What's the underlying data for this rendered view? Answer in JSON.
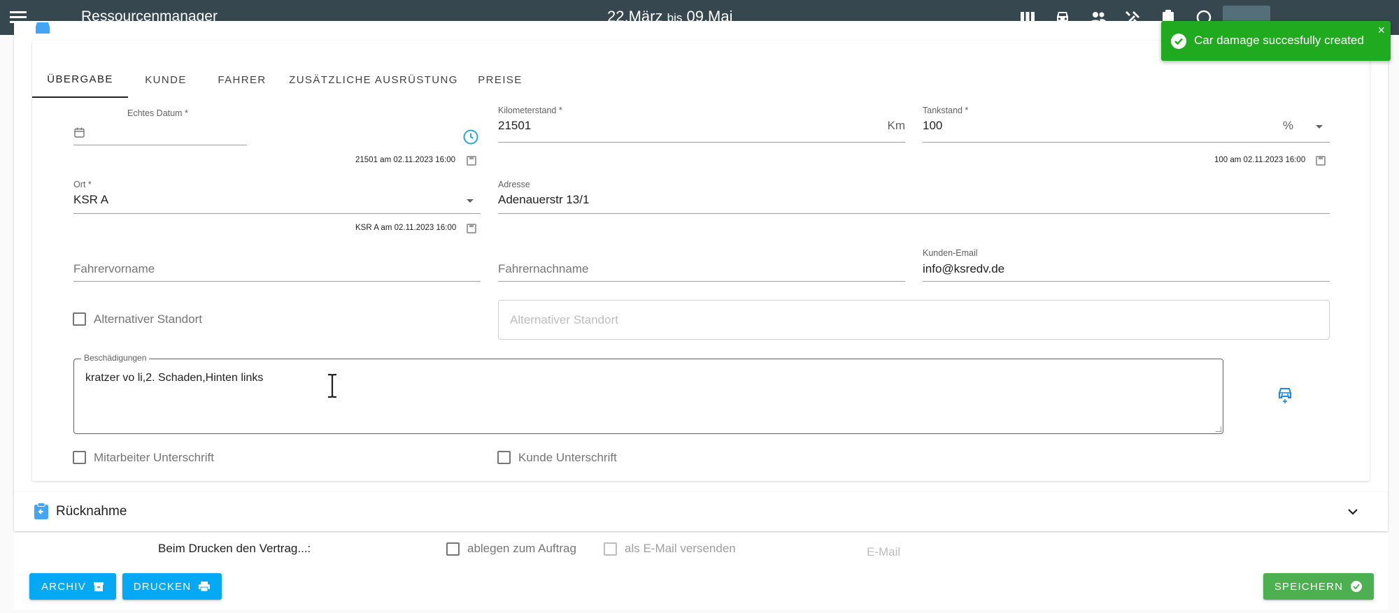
{
  "header": {
    "app_title": "Ressourcenmanager",
    "date_from": "22.März",
    "date_sep": "bis",
    "date_to": "09.Mai"
  },
  "toast": {
    "message": "Car damage succesfully created",
    "close_label": "×"
  },
  "handover": {
    "partial_value": "21501 Km"
  },
  "tabs": [
    {
      "label": "ÜBERGABE"
    },
    {
      "label": "KUNDE"
    },
    {
      "label": "FAHRER"
    },
    {
      "label": "ZUSÄTZLICHE AUSRÜSTUNG"
    },
    {
      "label": "PREISE"
    }
  ],
  "form": {
    "actual_date": {
      "label": "Echtes Datum *",
      "value": ""
    },
    "actual_date_hint": "21501 am 02.11.2023 16:00",
    "mileage": {
      "label": "Kilometerstand *",
      "value": "21501",
      "unit": "Km"
    },
    "fuel": {
      "label": "Tankstand *",
      "value": "100",
      "unit": "%"
    },
    "fuel_hint": "100 am 02.11.2023 16:00",
    "location": {
      "label": "Ort *",
      "value": "KSR A"
    },
    "location_hint": "KSR A am 02.11.2023 16:00",
    "address": {
      "label": "Adresse",
      "value": "Adenauerstr 13/1"
    },
    "driver_first": {
      "placeholder": "Fahrervorname"
    },
    "driver_last": {
      "placeholder": "Fahrernachname"
    },
    "customer_email": {
      "label": "Kunden-Email",
      "value": "info@ksredv.de"
    },
    "alt_location_checkbox": "Alternativer Standort",
    "alt_location_placeholder": "Alternativer Standort",
    "damages": {
      "label": "Beschädigungen",
      "value": "kratzer vo li,2. Schaden,Hinten links"
    },
    "employee_signature": "Mitarbeiter Unterschrift",
    "customer_signature": "Kunde Unterschrift"
  },
  "return_section": {
    "label": "Rücknahme"
  },
  "print_options": {
    "label": "Beim Drucken den Vertrag...:",
    "file_to_order": "ablegen zum Auftrag",
    "send_email": "als E-Mail versenden",
    "email_placeholder": "E-Mail"
  },
  "buttons": {
    "archive": "ARCHIV",
    "print": "DRUCKEN",
    "save": "SPEICHERN"
  },
  "colors": {
    "topbar": "#37474f",
    "toast": "#1faa20",
    "primary_button": "#03a9f4",
    "save_button": "#4caf50",
    "section_icon": "#42a5f5"
  },
  "icons": [
    "menu-icon",
    "columns-icon",
    "car-icon",
    "people-icon",
    "tools-icon",
    "clipboard-icon",
    "help-icon",
    "check-circle-icon",
    "calendar-icon",
    "clock-icon",
    "save-icon",
    "chevron-down-icon",
    "car-damage-icon",
    "archive-icon",
    "printer-icon"
  ]
}
